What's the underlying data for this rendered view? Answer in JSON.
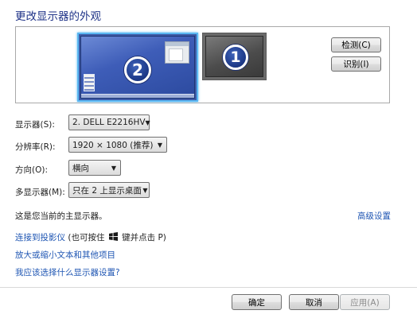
{
  "page": {
    "title": "更改显示器的外观"
  },
  "preview": {
    "monitor_primary_number": "2",
    "monitor_secondary_number": "1",
    "detect_label": "检测(C)",
    "identify_label": "识别(I)"
  },
  "fields": {
    "display_label": "显示器(S):",
    "display_value": "2. DELL E2216HV",
    "resolution_label": "分辨率(R):",
    "resolution_value": "1920 × 1080 (推荐)",
    "orientation_label": "方向(O):",
    "orientation_value": "横向",
    "multi_label": "多显示器(M):",
    "multi_value": "只在 2 上显示桌面"
  },
  "status": {
    "primary_note": "这是您当前的主显示器。",
    "advanced_link": "高级设置"
  },
  "links": {
    "projector_text": "连接到投影仪",
    "projector_hint_pre": "(也可按住",
    "projector_hint_post": "键并点击 P)",
    "text_size_link": "放大或缩小文本和其他项目",
    "which_settings_link": "我应该选择什么显示器设置?"
  },
  "footer": {
    "ok_label": "确定",
    "cancel_label": "取消",
    "apply_label": "应用(A)"
  },
  "icons": {
    "dropdown": "chevron-down-icon",
    "windows_key": "windows-logo-icon"
  },
  "colors": {
    "title": "#1e3287",
    "link": "#1f56b3",
    "selected_monitor_border": "#59b7f2"
  }
}
